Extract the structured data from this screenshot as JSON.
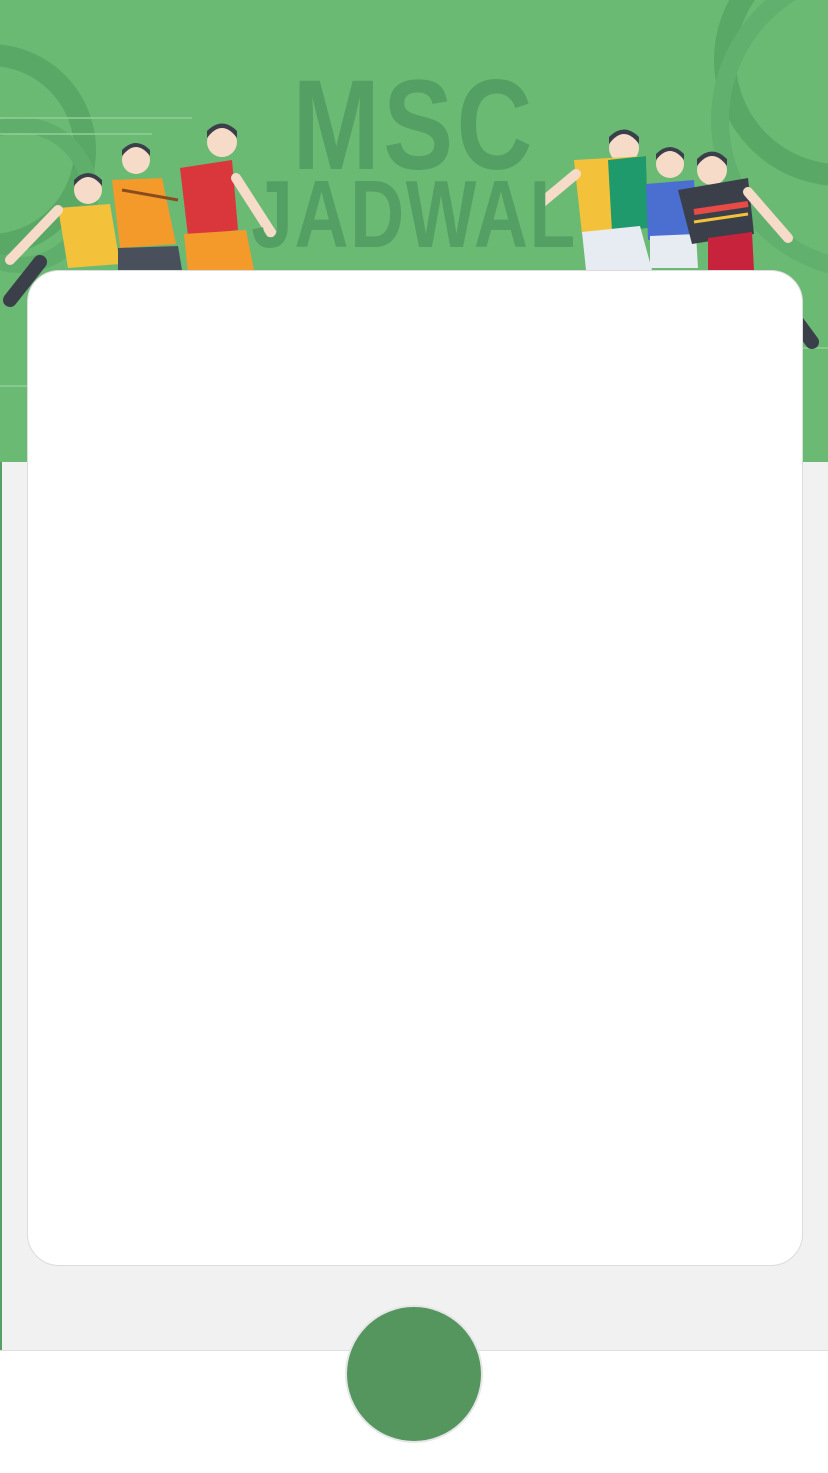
{
  "header": {
    "title_line1": "MSC",
    "title_line2": "JADWAL",
    "colors": {
      "background": "#6aba74",
      "title": "#54a064",
      "decoration": "#5aa866"
    },
    "illustration": "football-players-illustration"
  },
  "content": {
    "card_background": "#ffffff",
    "page_background": "#f1f1f1"
  },
  "bottom_nav": {
    "center_button_color": "#55965f",
    "center_button_icon": "home-button"
  }
}
